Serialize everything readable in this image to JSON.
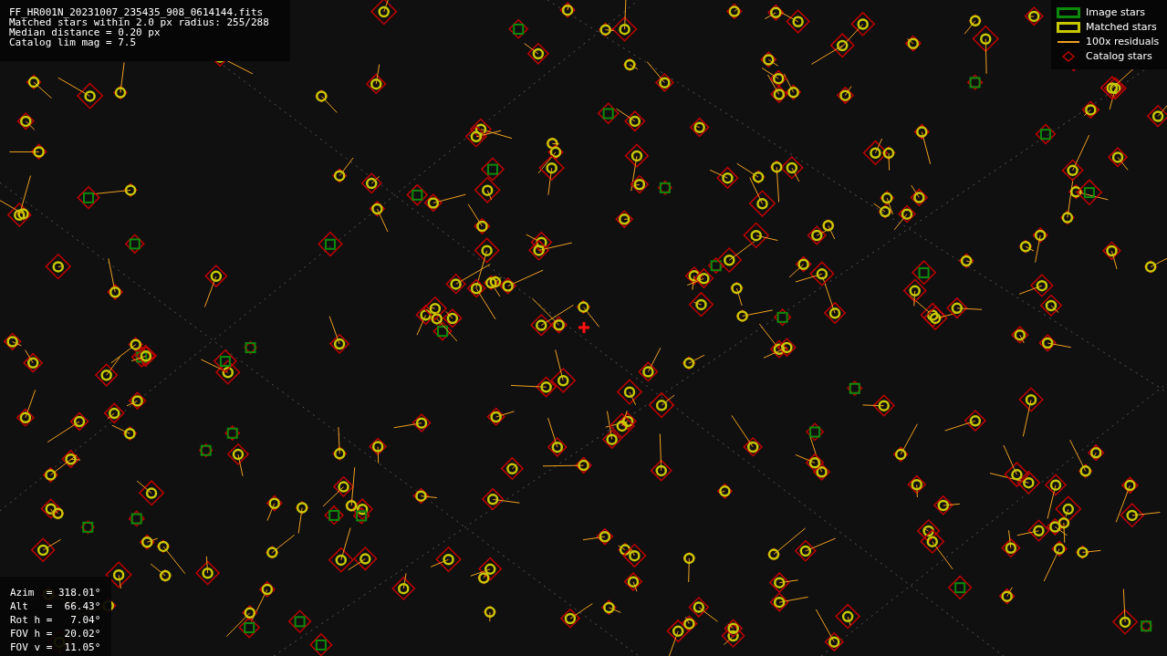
{
  "header": {
    "file_name": "FF_HR001N_20231007_235435_908_0614144.fits",
    "lines": [
      "Matched stars within 2.0 px radius: 255/288",
      "Median distance = 0.20 px",
      "Catalog lim mag = 7.5"
    ]
  },
  "legend": [
    {
      "kind": "image",
      "label": "Image stars",
      "color": "#0b8a0b"
    },
    {
      "kind": "matched",
      "label": "Matched stars",
      "color": "#c8c800"
    },
    {
      "kind": "residual",
      "label": "100x residuals",
      "color": "#f0a020"
    },
    {
      "kind": "catalog",
      "label": "Catalog stars",
      "color": "#c00000"
    }
  ],
  "pointing": [
    "Azim  = 318.01°",
    "Alt   =  66.43°",
    "Rot h =   7.04°",
    "FOV h =  20.02°",
    "FOV v =  11.05°"
  ]
}
